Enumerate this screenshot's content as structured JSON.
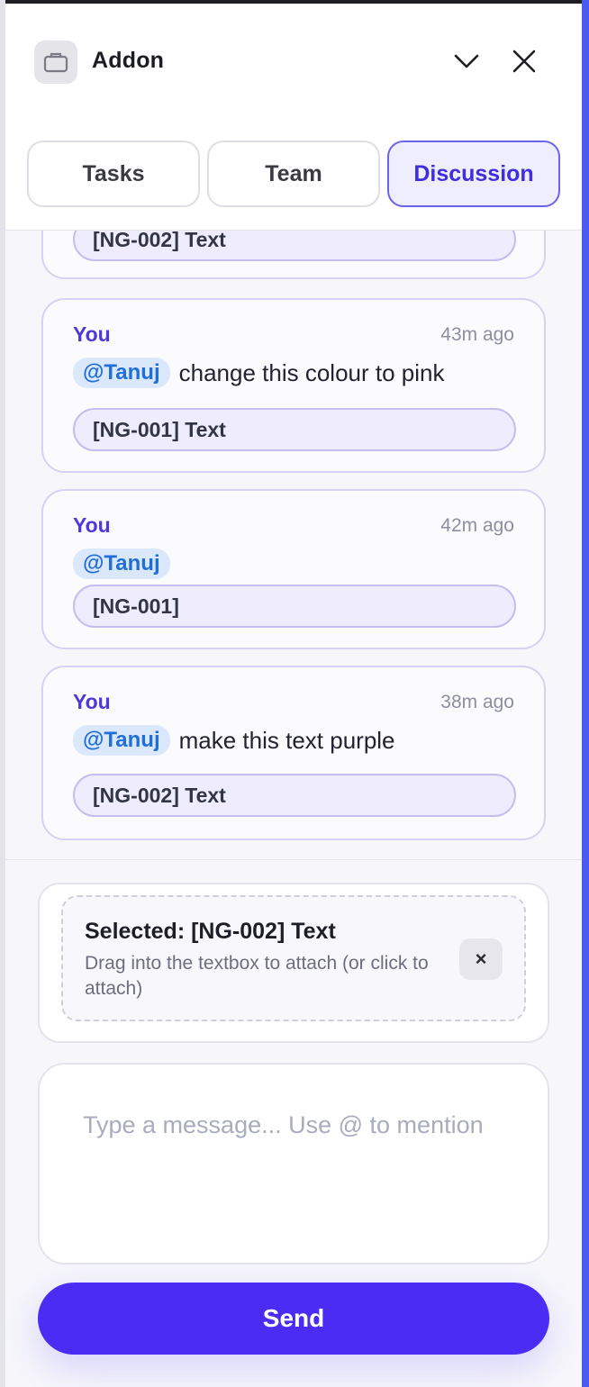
{
  "app": {
    "title": "Addon",
    "icon": "briefcase-icon",
    "accent_color": "#4a2cf5"
  },
  "header": {
    "collapse_icon": "chevron-down-icon",
    "close_icon": "close-icon"
  },
  "tabs": [
    {
      "label": "Tasks",
      "active": false
    },
    {
      "label": "Team",
      "active": false
    },
    {
      "label": "Discussion",
      "active": true
    }
  ],
  "messages": [
    {
      "author": "",
      "time": "",
      "mention": "",
      "text": "",
      "tag": "[NG-002] Text"
    },
    {
      "author": "You",
      "time": "43m ago",
      "mention": "@Tanuj",
      "text": "change this colour to pink",
      "tag": "[NG-001] Text"
    },
    {
      "author": "You",
      "time": "42m ago",
      "mention": "@Tanuj",
      "text": "",
      "tag": "[NG-001]"
    },
    {
      "author": "You",
      "time": "38m ago",
      "mention": "@Tanuj",
      "text": "make this text purple",
      "tag": "[NG-002] Text"
    }
  ],
  "selection": {
    "title": "Selected: [NG-002] Text",
    "hint": "Drag into the textbox to attach (or click to attach)",
    "clear_label": "×"
  },
  "composer": {
    "placeholder": "Type a message... Use @ to mention",
    "value": ""
  },
  "send_label": "Send"
}
